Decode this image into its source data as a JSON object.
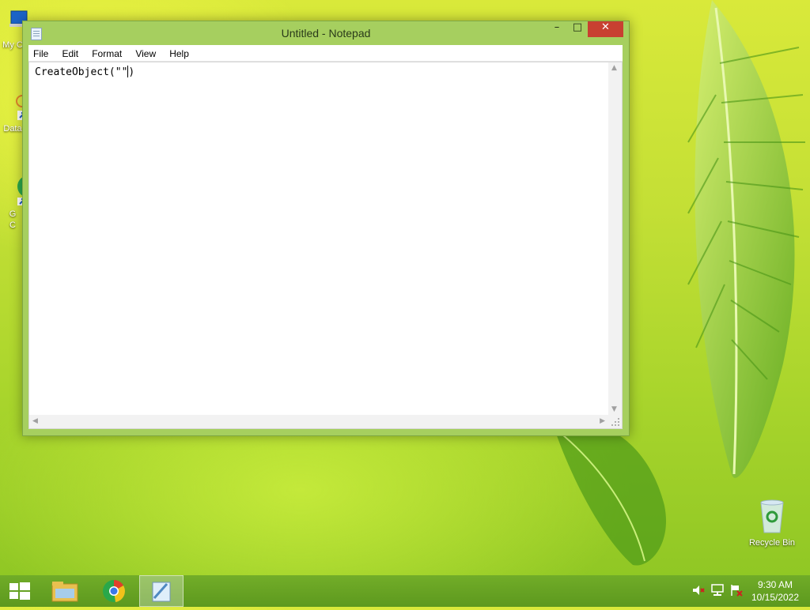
{
  "desktop": {
    "icons": [
      {
        "label": "My C",
        "icon": "computer-icon"
      },
      {
        "label": "Data",
        "icon": "shortcut-icon"
      },
      {
        "label": "G",
        "label2": "C",
        "icon": "chrome-icon"
      },
      {
        "label": "Recycle Bin",
        "icon": "recycle-bin-icon"
      }
    ]
  },
  "window": {
    "title": "Untitled - Notepad",
    "minimize_glyph": "–",
    "maximize_glyph": "□",
    "close_glyph": "✕"
  },
  "menu": [
    "File",
    "Edit",
    "Format",
    "View",
    "Help"
  ],
  "editor": {
    "text": "CreateObject(\"\")",
    "text_before_caret": "CreateObject(\"\"",
    "text_after_caret": ")"
  },
  "taskbar": {
    "items": [
      {
        "name": "start",
        "icon": "windows-logo-icon"
      },
      {
        "name": "file-explorer",
        "icon": "folder-icon"
      },
      {
        "name": "chrome",
        "icon": "chrome-icon"
      },
      {
        "name": "notepad",
        "icon": "notepad-icon",
        "active": true
      }
    ],
    "tray": [
      "volume-muted-icon",
      "network-icon",
      "action-center-flag-icon"
    ],
    "clock": {
      "time": "9:30 AM",
      "date": "10/15/2022"
    }
  },
  "colors": {
    "close_button": "#c84031",
    "window_frame": "#a6cf5f",
    "taskbar": "#6aa628"
  }
}
